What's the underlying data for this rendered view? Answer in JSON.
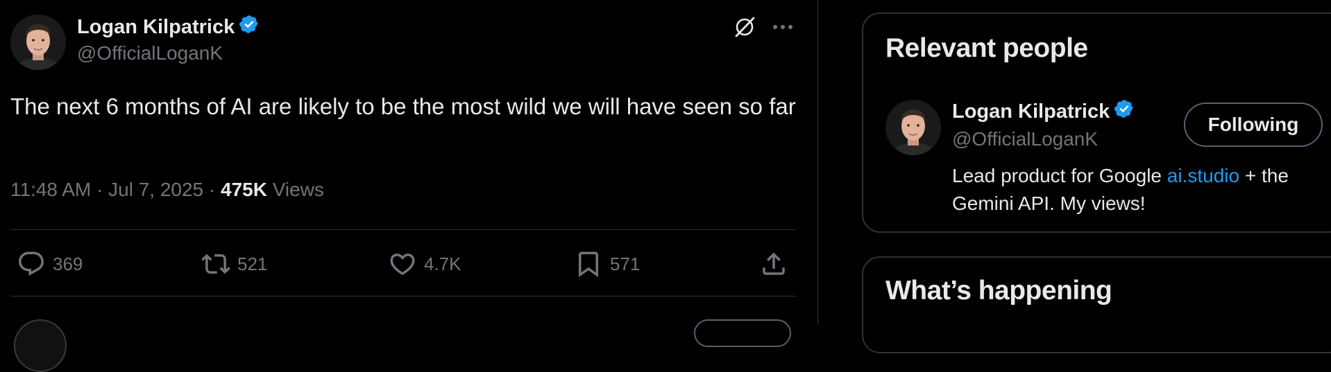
{
  "tweet": {
    "author": {
      "name": "Logan Kilpatrick",
      "handle": "@OfficialLoganK",
      "verified": true
    },
    "text": "The next 6 months of AI are likely to be the most wild we will have seen so far",
    "time": "11:48 AM",
    "date": "Jul 7, 2025",
    "separator": "·",
    "views_count": "475K",
    "views_label": "Views",
    "actions": {
      "replies": "369",
      "reposts": "521",
      "likes": "4.7K",
      "bookmarks": "571"
    }
  },
  "sidebar": {
    "relevant_people": {
      "title": "Relevant people",
      "person": {
        "name": "Logan Kilpatrick",
        "handle": "@OfficialLoganK",
        "bio_before": "Lead product for Google ",
        "bio_link": "ai.studio",
        "bio_after": " + the Gemini API. My views!",
        "follow_label": "Following"
      }
    },
    "whats_happening": {
      "title": "What’s happening"
    }
  },
  "colors": {
    "background": "#000000",
    "text_primary": "#e7e9ea",
    "text_secondary": "#71767b",
    "border": "#2f3336",
    "accent": "#1d9bf0"
  },
  "icons": [
    "verified-badge-icon",
    "grok-icon",
    "more-icon",
    "reply-icon",
    "repost-icon",
    "like-icon",
    "bookmark-icon",
    "share-icon"
  ]
}
